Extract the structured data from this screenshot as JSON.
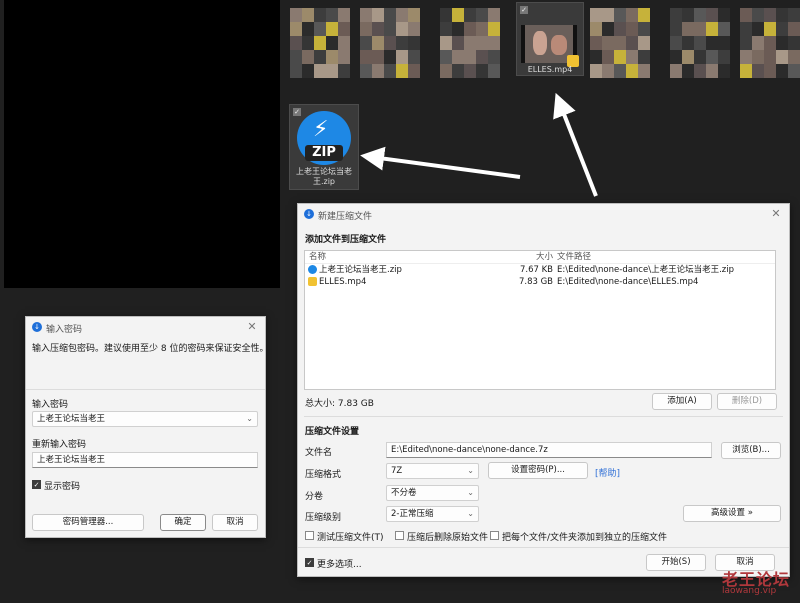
{
  "desktop": {
    "video_file": {
      "name": "ELLES.mp4"
    },
    "zip_file": {
      "name": "上老王论坛当老王.zip",
      "icon_text": "ZIP"
    }
  },
  "new_archive_dialog": {
    "title": "新建压缩文件",
    "section_title": "添加文件到压缩文件",
    "columns": [
      "名称",
      "大小",
      "文件路径"
    ],
    "files": [
      {
        "icon": "zip-file-icon",
        "name": "上老王论坛当老王.zip",
        "size": "7.67 KB",
        "path": "E:\\Edited\\none-dance\\上老王论坛当老王.zip"
      },
      {
        "icon": "video-file-icon",
        "name": "ELLES.mp4",
        "size": "7.83 GB",
        "path": "E:\\Edited\\none-dance\\ELLES.mp4"
      }
    ],
    "total_size": "总大小: 7.83 GB",
    "add_button": "添加(A)",
    "delete_button": "删除(D)",
    "settings_title": "压缩文件设置",
    "filename_label": "文件名",
    "filename_value": "E:\\Edited\\none-dance\\none-dance.7z",
    "browse_button": "浏览(B)...",
    "format_label": "压缩格式",
    "format_value": "7Z",
    "set_password_button": "设置密码(P)...",
    "help_link": "[帮助]",
    "split_label": "分卷",
    "split_value": "不分卷",
    "level_label": "压缩级别",
    "level_value": "2-正常压缩",
    "advanced_button": "高级设置 »",
    "options": [
      {
        "label": "测试压缩文件(T)",
        "checked": false
      },
      {
        "label": "压缩后删除原始文件",
        "checked": false
      },
      {
        "label": "把每个文件/文件夹添加到独立的压缩文件",
        "checked": false
      }
    ],
    "more_options": {
      "label": "更多选项...",
      "checked": true
    },
    "start_button": "开始(S)",
    "cancel_button": "取消"
  },
  "password_dialog": {
    "title": "输入密码",
    "description": "输入压缩包密码。建议使用至少 8 位的密码来保证安全性。",
    "password_label": "输入密码",
    "password_value": "上老王论坛当老王",
    "reenter_label": "重新输入密码",
    "reenter_value": "上老王论坛当老王",
    "show_password": {
      "label": "显示密码",
      "checked": true
    },
    "manager_button": "密码管理器...",
    "ok_button": "确定",
    "cancel_button": "取消"
  },
  "watermark": {
    "text": "老王论坛",
    "url": "laowang.vip"
  },
  "colors": {
    "accent": "#1e88e5",
    "watermark": "#b0383c"
  }
}
